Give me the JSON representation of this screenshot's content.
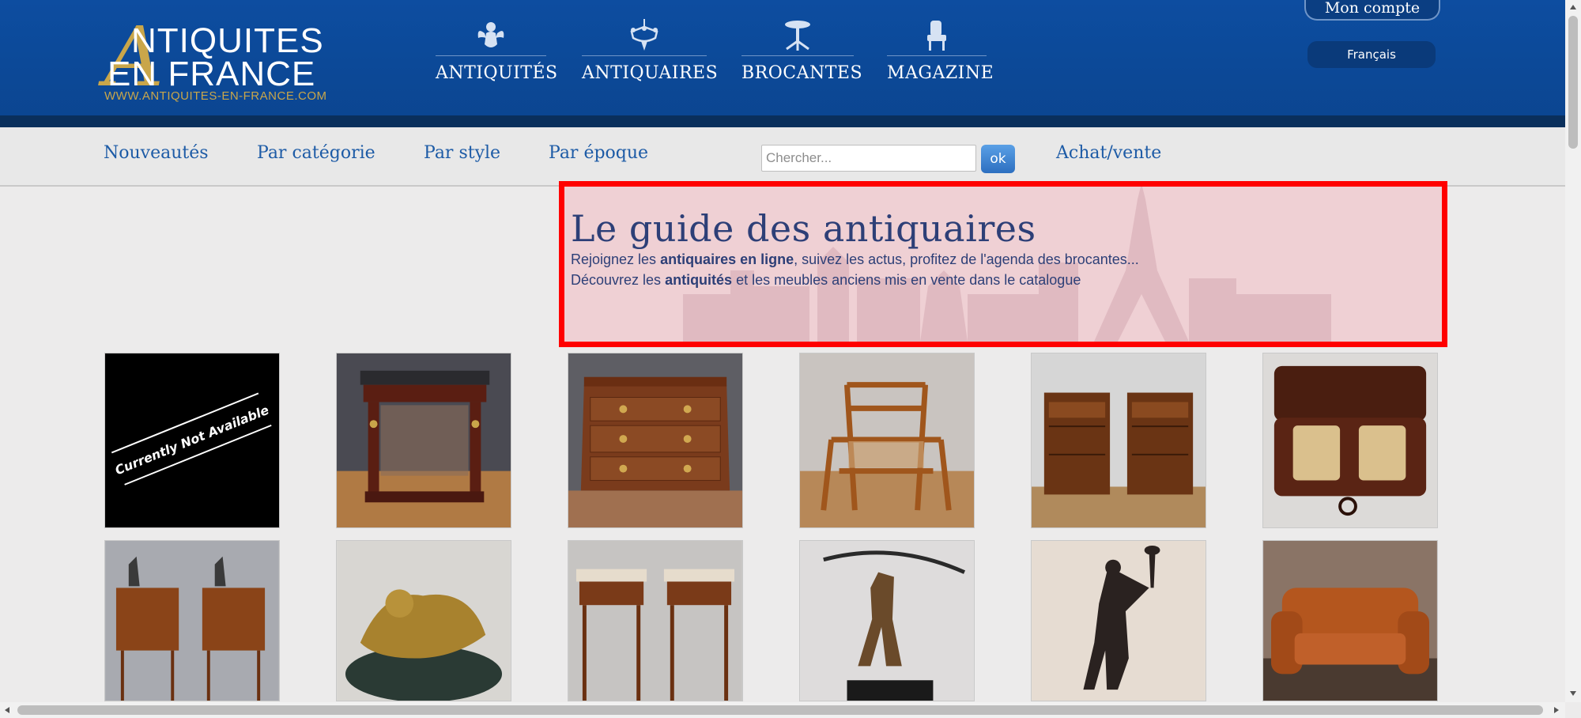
{
  "logo": {
    "line1": "NTIQUITES",
    "line2": "EN FRANCE",
    "big_letter": "A",
    "url": "WWW.ANTIQUITES-EN-FRANCE.COM"
  },
  "main_nav": [
    {
      "label": "ANTIQUITÉS",
      "icon": "cherub-icon"
    },
    {
      "label": "ANTIQUAIRES",
      "icon": "chandelier-icon"
    },
    {
      "label": "BROCANTES",
      "icon": "pedestal-table-icon"
    },
    {
      "label": "MAGAZINE",
      "icon": "armchair-icon"
    }
  ],
  "account": {
    "label": "Mon compte"
  },
  "language": {
    "selected": "Français"
  },
  "sub_nav": [
    "Nouveautés",
    "Par catégorie",
    "Par style",
    "Par époque"
  ],
  "search": {
    "placeholder": "Chercher...",
    "button": "ok"
  },
  "achat_vente": "Achat/vente",
  "hero": {
    "title": "Le guide des antiquaires",
    "line1_pre": "Rejoignez les ",
    "line1_bold": "antiquaires en ligne",
    "line1_post": ", suivez les actus, profitez de l'agenda des brocantes...",
    "line2_pre": "Découvrez les ",
    "line2_bold": "antiquités",
    "line2_post": " et les meubles anciens mis en vente dans le catalogue"
  },
  "products": [
    {
      "name": "unavailable",
      "label": "Currently Not Available"
    },
    {
      "name": "console-table"
    },
    {
      "name": "commode"
    },
    {
      "name": "bamboo-armchair"
    },
    {
      "name": "pair-nightstands"
    },
    {
      "name": "liquor-box"
    },
    {
      "name": "pair-side-tables-bronzes"
    },
    {
      "name": "bronze-cherubs"
    },
    {
      "name": "pair-marble-tables"
    },
    {
      "name": "archer-bronze"
    },
    {
      "name": "torch-bearer-bronze"
    },
    {
      "name": "leather-sofa"
    }
  ],
  "colors": {
    "header_blue": "#0d4da0",
    "gold": "#c9a64a",
    "link_blue": "#1d5ba6",
    "highlight_red": "#ff0000"
  }
}
